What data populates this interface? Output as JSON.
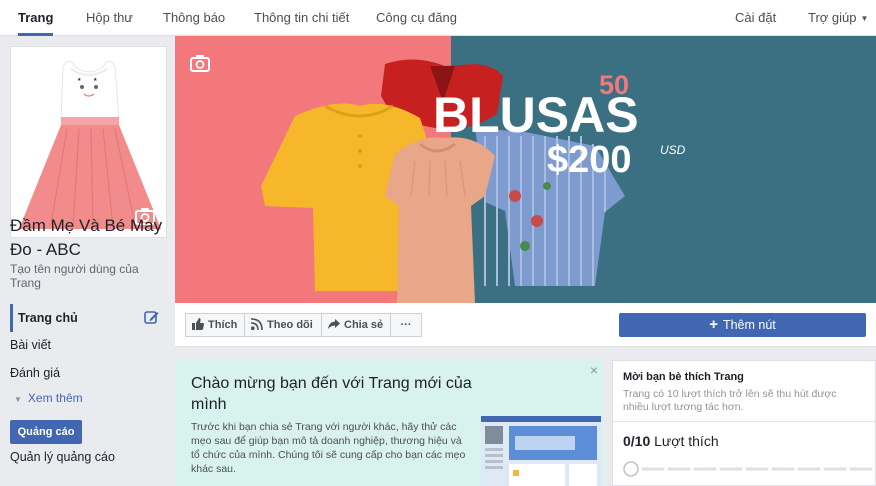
{
  "nav": {
    "tabs": [
      "Trang",
      "Hộp thư",
      "Thông báo",
      "Thông tin chi tiết",
      "Công cụ đăng"
    ],
    "settings": "Cài đặt",
    "help": "Trợ giúp"
  },
  "page": {
    "name": "Đầm Mẹ Và Bé May Đo - ABC",
    "username_prompt": "Tạo tên người dùng của Trang"
  },
  "sidebar": {
    "items": [
      "Trang chủ",
      "Bài viết",
      "Đánh giá"
    ],
    "see_more": "Xem thêm",
    "promote": "Quảng cáo",
    "manage_ads": "Quản lý quảng cáo"
  },
  "cover": {
    "badge_number": "50",
    "headline": "BLUSAS",
    "price": "$200",
    "currency": "USD"
  },
  "actions": {
    "like": "Thích",
    "follow": "Theo dõi",
    "share": "Chia sẻ",
    "more": "···",
    "add_button": "Thêm nút"
  },
  "welcome": {
    "title": "Chào mừng bạn đến với Trang mới của mình",
    "body": "Trước khi bạn chia sẻ Trang với người khác, hãy thử các mẹo sau để giúp bạn mô tả doanh nghiệp, thương hiệu và tổ chức của mình. Chúng tôi sẽ cung cấp cho bạn các mẹo khác sau.",
    "close": "×"
  },
  "invite": {
    "title": "Mời bạn bè thích Trang",
    "body": "Trang có 10 lượt thích trở lên sẽ thu hút được nhiều lượt tương tác hơn.",
    "count": "0/10",
    "count_label": "Lượt thích",
    "progress": 0
  },
  "colors": {
    "brand": "#4267b2",
    "cover_pink": "#f2787b",
    "cover_teal": "#3b6f82",
    "welcome_bg": "#d8f2ee"
  },
  "icons": [
    "camera-icon",
    "pencil-icon",
    "thumbs-up-icon",
    "rss-icon",
    "share-arrow-icon",
    "chevron-down-icon",
    "close-icon"
  ]
}
